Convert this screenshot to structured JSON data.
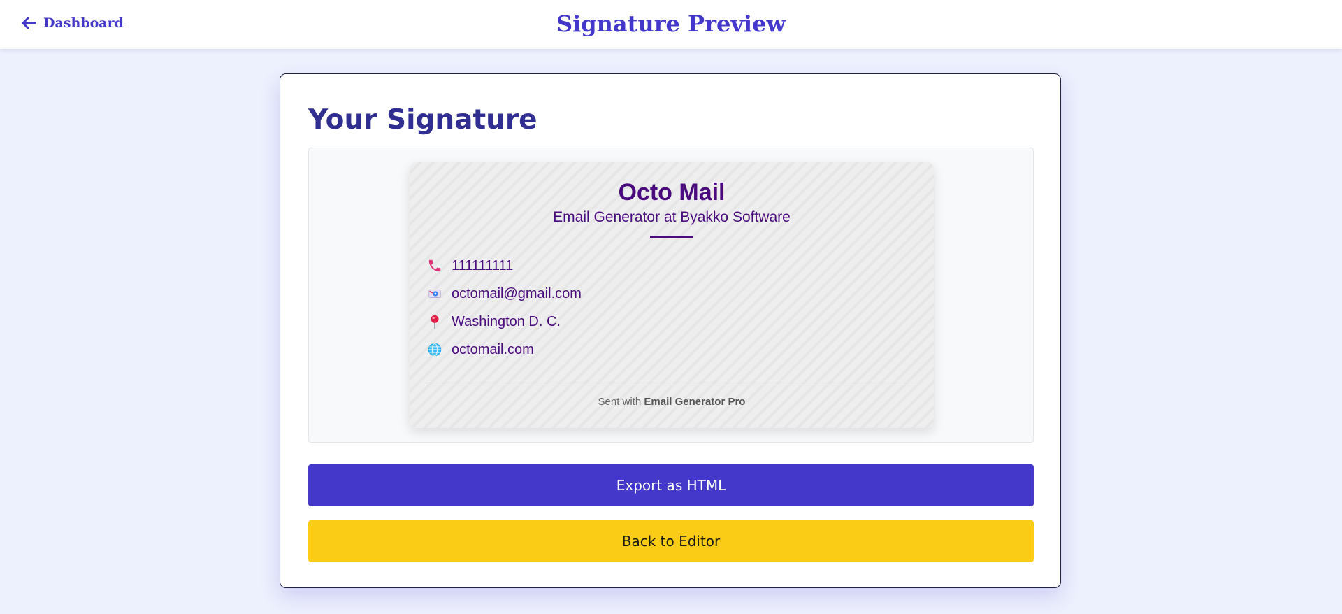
{
  "header": {
    "back_label": "Dashboard",
    "title": "Signature Preview"
  },
  "card": {
    "title": "Your Signature",
    "export_label": "Export as HTML",
    "back_label": "Back to Editor"
  },
  "signature": {
    "name": "Octo Mail",
    "role": "Email Generator at Byakko Software",
    "contacts": [
      {
        "icon": "phone-icon",
        "text": "111111111"
      },
      {
        "icon": "email-icon",
        "text": "octomail@gmail.com"
      },
      {
        "icon": "location-pin-icon",
        "text": "Washington D. C."
      },
      {
        "icon": "globe-icon",
        "text": "octomail.com"
      }
    ],
    "footer_prefix": "Sent with",
    "footer_brand": "Email Generator Pro"
  },
  "colors": {
    "accent": "#4338ca",
    "secondary_button": "#facc15",
    "signature_text": "#4b0b7f",
    "background": "#edf0fd"
  }
}
